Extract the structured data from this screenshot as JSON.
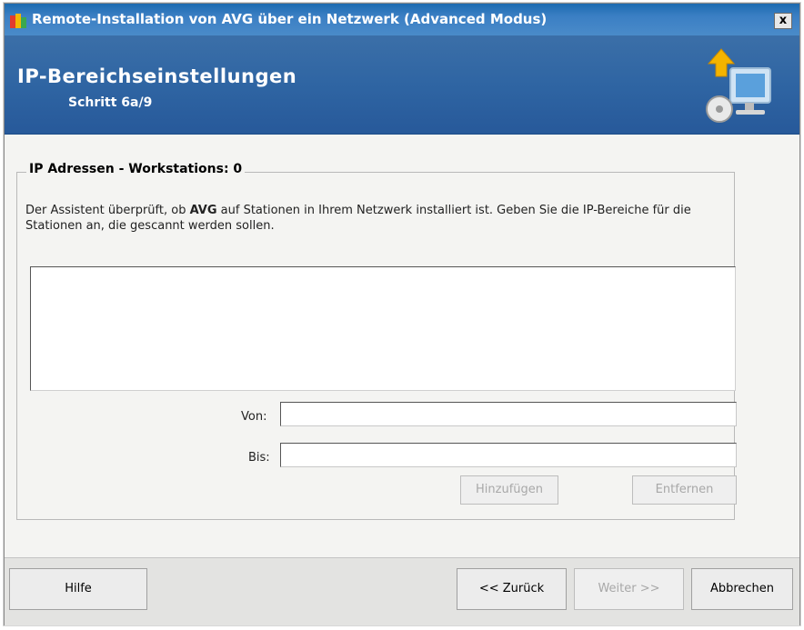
{
  "window": {
    "title": "Remote-Installation von AVG über ein Netzwerk (Advanced Modus)",
    "close_label": "x"
  },
  "banner": {
    "title": "IP-Bereichseinstellungen",
    "step": "Schritt 6a/9"
  },
  "group": {
    "legend": "IP Adressen - Workstations: 0",
    "desc_part1": "Der Assistent überprüft, ob ",
    "desc_bold": "AVG",
    "desc_part2": " auf Stationen in Ihrem Netzwerk installiert ist. Geben Sie die IP-Bereiche für die Stationen an, die gescannt werden sollen.",
    "from_label": "Von:",
    "from_value": "",
    "to_label": "Bis:",
    "to_value": "",
    "add_button": "Hinzufügen",
    "remove_button": "Entfernen"
  },
  "footer": {
    "help_button": "Hilfe",
    "back_button": "<< Zurück",
    "next_button": "Weiter >>",
    "cancel_button": "Abbrechen"
  },
  "colors": {
    "titlebar": "#1d6bb0",
    "banner": "#2f65a3",
    "content_bg": "#f4f4f2"
  }
}
